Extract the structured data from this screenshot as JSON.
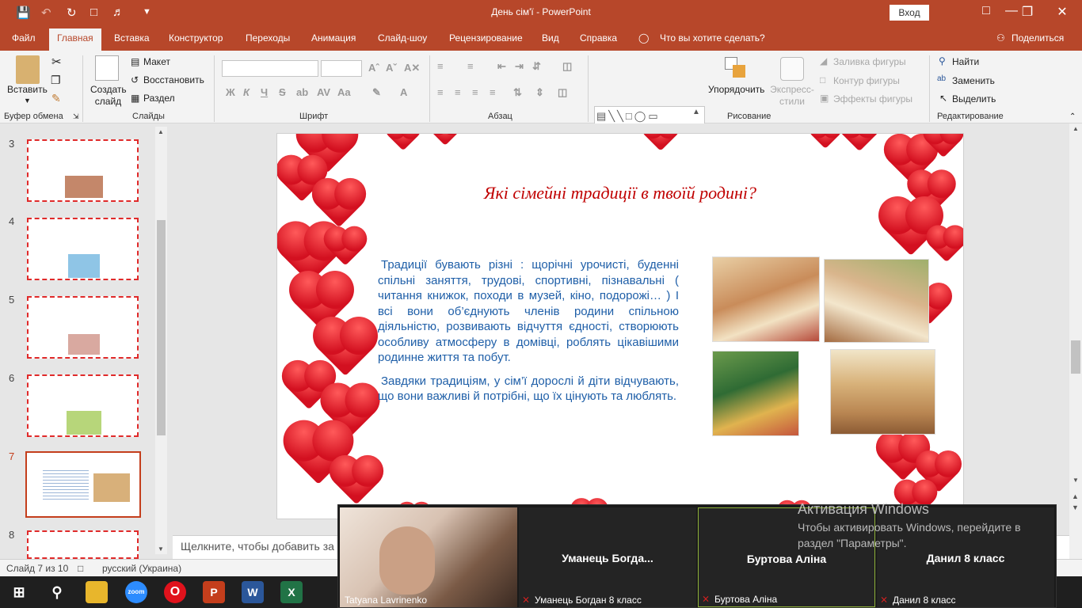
{
  "window": {
    "title": "День сім'ї  -  PowerPoint",
    "signin_label": "Вход"
  },
  "tabs": [
    "Файл",
    "Главная",
    "Вставка",
    "Конструктор",
    "Переходы",
    "Анимация",
    "Слайд-шоу",
    "Рецензирование",
    "Вид",
    "Справка"
  ],
  "tell_me": "Что вы хотите сделать?",
  "share": "Поделиться",
  "ribbon": {
    "paste": "Вставить",
    "clipboard": "Буфер обмена",
    "new_slide": "Создать слайд",
    "layout": "Макет",
    "reset": "Восстановить",
    "section": "Раздел",
    "slides": "Слайды",
    "font": "Шрифт",
    "paragraph": "Абзац",
    "arrange": "Упорядочить",
    "quick_styles": "Экспресс-стили",
    "shape_fill": "Заливка фигуры",
    "shape_outline": "Контур фигуры",
    "shape_effects": "Эффекты фигуры",
    "drawing": "Рисование",
    "find": "Найти",
    "replace": "Заменить",
    "select": "Выделить",
    "editing": "Редактирование"
  },
  "thumbnails": [
    {
      "num": "3",
      "selected": false
    },
    {
      "num": "4",
      "selected": false
    },
    {
      "num": "5",
      "selected": false
    },
    {
      "num": "6",
      "selected": false
    },
    {
      "num": "7",
      "selected": true
    },
    {
      "num": "8",
      "selected": false
    }
  ],
  "slide": {
    "title": "Які сімейні традиції в твоїй родині?",
    "para1": "Традиції бувають різні : щорічні урочисті, буденні спільні заняття, трудові, спортивні, пізнавальні ( читання книжок, походи в музей, кіно, подорожі… ) І всі вони об’єднують членів родини спільною діяльністю, розвивають відчуття єдності, створюють особливу атмосферу в домівці, роблять цікавішими родинне життя та побут.",
    "para2": "Завдяки традиціям, у сім’ї дорослі й діти відчувають, що вони важливі й потрібні, що їх цінують та люблять."
  },
  "notes_placeholder": "Щелкните, чтобы добавить за",
  "status": {
    "slide_of": "Слайд 7 из 10",
    "language": "русский (Украина)"
  },
  "zoom_tiles": [
    {
      "big": "",
      "small": "Tatyana Lavrinenko"
    },
    {
      "big": "Уманець  Богда...",
      "small": "Уманець Богдан 8 класс"
    },
    {
      "big": "Буртова Аліна",
      "small": "Буртова Аліна"
    },
    {
      "big": "Данил 8 класс",
      "small": "Данил 8 класс"
    }
  ],
  "activation": {
    "title": "Активация Windows",
    "line1": "Чтобы активировать Windows, перейдите в",
    "line2": "раздел \"Параметры\"."
  },
  "taskbar_icons": [
    "start-icon",
    "search-icon",
    "file-explorer-icon",
    "zoom-icon",
    "opera-icon",
    "powerpoint-icon",
    "word-icon",
    "excel-icon"
  ],
  "colors": {
    "accent": "#b7472a",
    "slide_title": "#c00000",
    "slide_text": "#1f5fa8"
  }
}
